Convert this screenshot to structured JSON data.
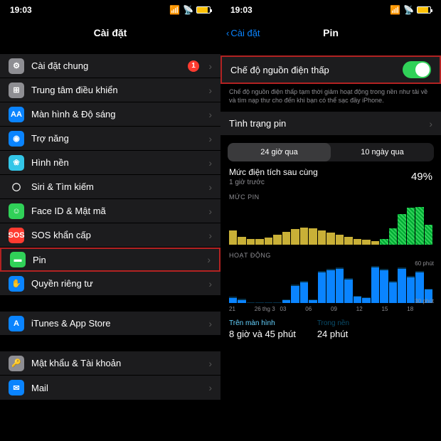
{
  "status": {
    "time": "19:03",
    "signal": "▪▪▪▪",
    "wifi": "📶"
  },
  "left": {
    "title": "Cài đặt",
    "items": [
      {
        "label": "Cài đặt chung",
        "icon_bg": "#8e8e93",
        "icon": "⚙",
        "badge": "1"
      },
      {
        "label": "Trung tâm điều khiển",
        "icon_bg": "#8e8e93",
        "icon": "⊞"
      },
      {
        "label": "Màn hình & Độ sáng",
        "icon_bg": "#0a84ff",
        "icon": "AA"
      },
      {
        "label": "Trợ năng",
        "icon_bg": "#0a84ff",
        "icon": "◉"
      },
      {
        "label": "Hình nền",
        "icon_bg": "#33c6e8",
        "icon": "❀"
      },
      {
        "label": "Siri & Tìm kiếm",
        "icon_bg": "#1c1c1e",
        "icon": "◯"
      },
      {
        "label": "Face ID & Mật mã",
        "icon_bg": "#30d158",
        "icon": "☺"
      },
      {
        "label": "SOS khẩn cấp",
        "icon_bg": "#ff3b30",
        "icon": "SOS"
      },
      {
        "label": "Pin",
        "icon_bg": "#30d158",
        "icon": "▬",
        "highlight": true
      },
      {
        "label": "Quyền riêng tư",
        "icon_bg": "#0a84ff",
        "icon": "✋"
      }
    ],
    "group2": [
      {
        "label": "iTunes & App Store",
        "icon_bg": "#0a84ff",
        "icon": "A"
      }
    ],
    "group3": [
      {
        "label": "Mật khẩu & Tài khoản",
        "icon_bg": "#8e8e93",
        "icon": "🔑"
      },
      {
        "label": "Mail",
        "icon_bg": "#0a84ff",
        "icon": "✉"
      }
    ]
  },
  "right": {
    "back": "Cài đặt",
    "title": "Pin",
    "low_power": {
      "label": "Chế độ nguồn điện thấp",
      "on": true
    },
    "desc": "Chế độ nguồn điện thấp tạm thời giảm hoạt động trong nền như tải về và tìm nạp thư cho đến khi bạn có thể sạc đầy iPhone.",
    "health": {
      "label": "Tình trạng pin"
    },
    "seg": {
      "a": "24 giờ qua",
      "b": "10 ngày qua"
    },
    "last_charge": {
      "label": "Mức điện tích sau cùng",
      "sub": "1 giờ trước",
      "pct": "49%"
    },
    "battery_level_label": "MỨC PIN",
    "activity_label": "HOẠT ĐỘNG",
    "axis_act_top": "60 phút",
    "axis_act_bot": "30 phút",
    "xlabels": [
      "21",
      "26 thg 3",
      "03",
      "06",
      "09",
      "12",
      "15",
      "18"
    ],
    "footer": {
      "screen_label": "Trên màn hình",
      "screen_val": "8 giờ và 45 phút",
      "bg_label": "Trong nền",
      "bg_val": "24 phút"
    }
  },
  "chart_data": [
    {
      "type": "bar",
      "title": "MỨC PIN",
      "ylabel": "%",
      "ylim": [
        0,
        100
      ],
      "x": [
        "21",
        "22",
        "23",
        "00",
        "01",
        "02",
        "03",
        "04",
        "05",
        "06",
        "07",
        "08",
        "09",
        "10",
        "11",
        "12",
        "13",
        "14",
        "15",
        "16",
        "17",
        "18",
        "19"
      ],
      "values": [
        35,
        20,
        15,
        15,
        18,
        25,
        32,
        38,
        42,
        40,
        36,
        30,
        25,
        20,
        15,
        12,
        10,
        15,
        40,
        75,
        90,
        92,
        49
      ],
      "charging_hours": [
        "14",
        "15",
        "16",
        "17",
        "18",
        "19"
      ]
    },
    {
      "type": "bar",
      "title": "HOẠT ĐỘNG",
      "ylabel": "phút",
      "ylim": [
        0,
        60
      ],
      "x": [
        "21",
        "22",
        "23",
        "00",
        "01",
        "02",
        "03",
        "04",
        "05",
        "06",
        "07",
        "08",
        "09",
        "10",
        "11",
        "12",
        "13",
        "14",
        "15",
        "16",
        "17",
        "18",
        "19"
      ],
      "series": [
        {
          "name": "Trên màn hình",
          "color": "#0a84ff",
          "values": [
            8,
            5,
            0,
            0,
            0,
            0,
            5,
            25,
            30,
            5,
            45,
            48,
            50,
            35,
            10,
            8,
            52,
            48,
            30,
            50,
            38,
            45,
            20
          ]
        },
        {
          "name": "Trong nền",
          "color": "#05314a",
          "values": [
            2,
            2,
            1,
            1,
            1,
            1,
            1,
            2,
            2,
            1,
            2,
            2,
            2,
            2,
            1,
            1,
            2,
            2,
            2,
            2,
            2,
            2,
            1
          ]
        }
      ]
    }
  ]
}
